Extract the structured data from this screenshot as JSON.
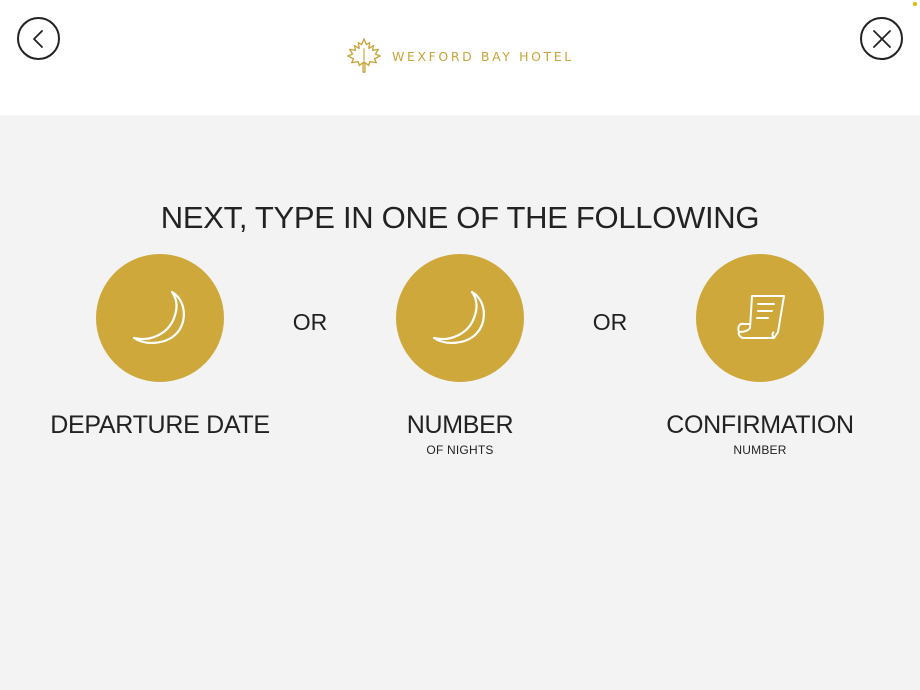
{
  "header": {
    "brand": "WEXFORD BAY HOTEL",
    "logo_icon": "maple-leaf-icon",
    "back_icon": "chevron-left-icon",
    "close_icon": "close-icon"
  },
  "main": {
    "heading": "NEXT, TYPE IN ONE OF THE FOLLOWING",
    "separator": "OR",
    "options": [
      {
        "title": "DEPARTURE DATE",
        "subtitle": "",
        "icon": "moon-icon"
      },
      {
        "title": "NUMBER",
        "subtitle": "OF NIGHTS",
        "icon": "moon-icon"
      },
      {
        "title": "CONFIRMATION",
        "subtitle": "NUMBER",
        "icon": "receipt-scroll-icon"
      }
    ]
  },
  "colors": {
    "accent_gold": "#cea83b",
    "brand_gold": "#c9a43a",
    "background": "#f3f3f3",
    "header_background": "#ffffff",
    "text": "#222222",
    "status_dot": "#e8b400"
  }
}
